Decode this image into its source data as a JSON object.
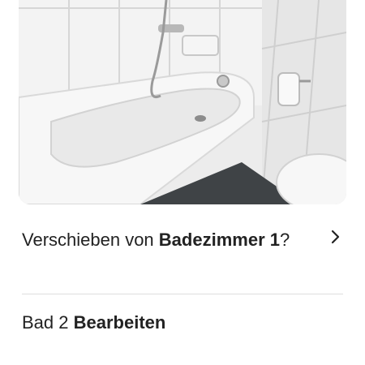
{
  "photo": {
    "subject": "bathroom-bathtub-photo"
  },
  "move_room": {
    "prefix": "Verschieben von",
    "room_name": "Badezimmer",
    "room_number": "1",
    "suffix": "?"
  },
  "rename": {
    "current_name": "Bad 2",
    "action_label": "Bearbeiten"
  },
  "icons": {
    "move_chevron": "chevron-right-icon"
  },
  "colors": {
    "text": "#222222",
    "divider": "#dddddd"
  }
}
